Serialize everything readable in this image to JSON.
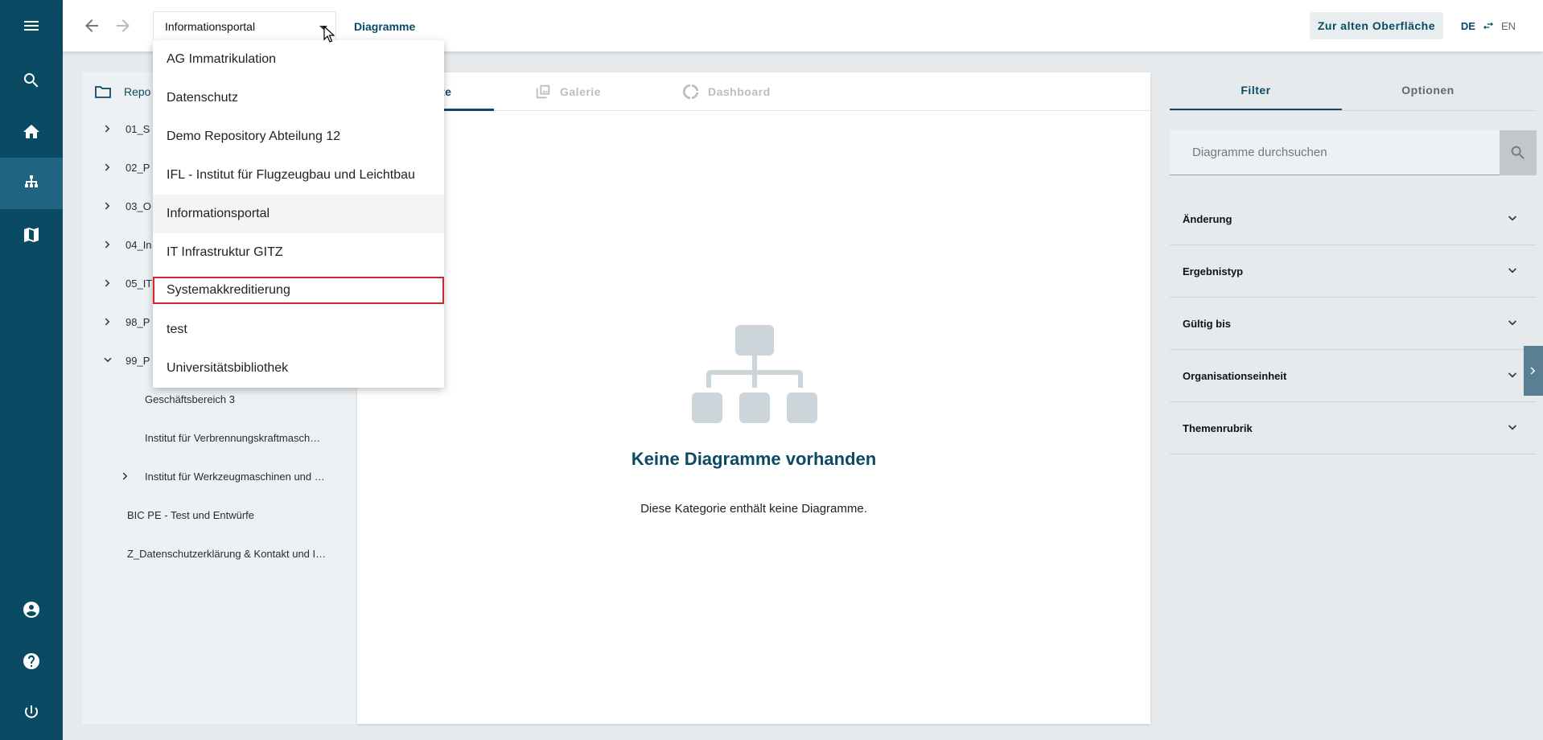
{
  "topbar": {
    "repository_selected": "Informationsportal",
    "breadcrumb": "Diagramme",
    "old_ui_button": "Zur alten Oberfläche",
    "lang_de": "DE",
    "lang_en": "EN"
  },
  "dropdown": {
    "options": [
      "AG Immatrikulation",
      "Datenschutz",
      "Demo Repository Abteilung 12",
      "IFL - Institut für Flugzeugbau und Leichtbau",
      "Informationsportal",
      "IT Infrastruktur GITZ",
      "Systemakkreditierung",
      "test",
      "Universitätsbibliothek"
    ]
  },
  "tree": {
    "root_label": "Repo",
    "items": [
      "01_S",
      "02_P",
      "03_O",
      "04_In",
      "05_IT",
      "98_P",
      "99_P",
      "Geschäftsbereich 3",
      "Institut für Verbrennungskraftmasch…",
      "Institut für Werkzeugmaschinen und …",
      "BIC PE - Test und Entwürfe",
      "Z_Datenschutzerklärung & Kontakt und I…"
    ]
  },
  "main": {
    "tabs": [
      "te",
      "Galerie",
      "Dashboard"
    ],
    "empty_title": "Keine Diagramme vorhanden",
    "empty_text": "Diese Kategorie enthält keine Diagramme."
  },
  "filter_panel": {
    "tabs": [
      "Filter",
      "Optionen"
    ],
    "search_placeholder": "Diagramme durchsuchen",
    "sections": [
      "Änderung",
      "Ergebnistyp",
      "Gültig bis",
      "Organisationseinheit",
      "Themenrubrik"
    ]
  },
  "colors": {
    "primary": "#0b4a63",
    "rail_active": "#1f6480",
    "highlight_border": "#d2262b"
  }
}
